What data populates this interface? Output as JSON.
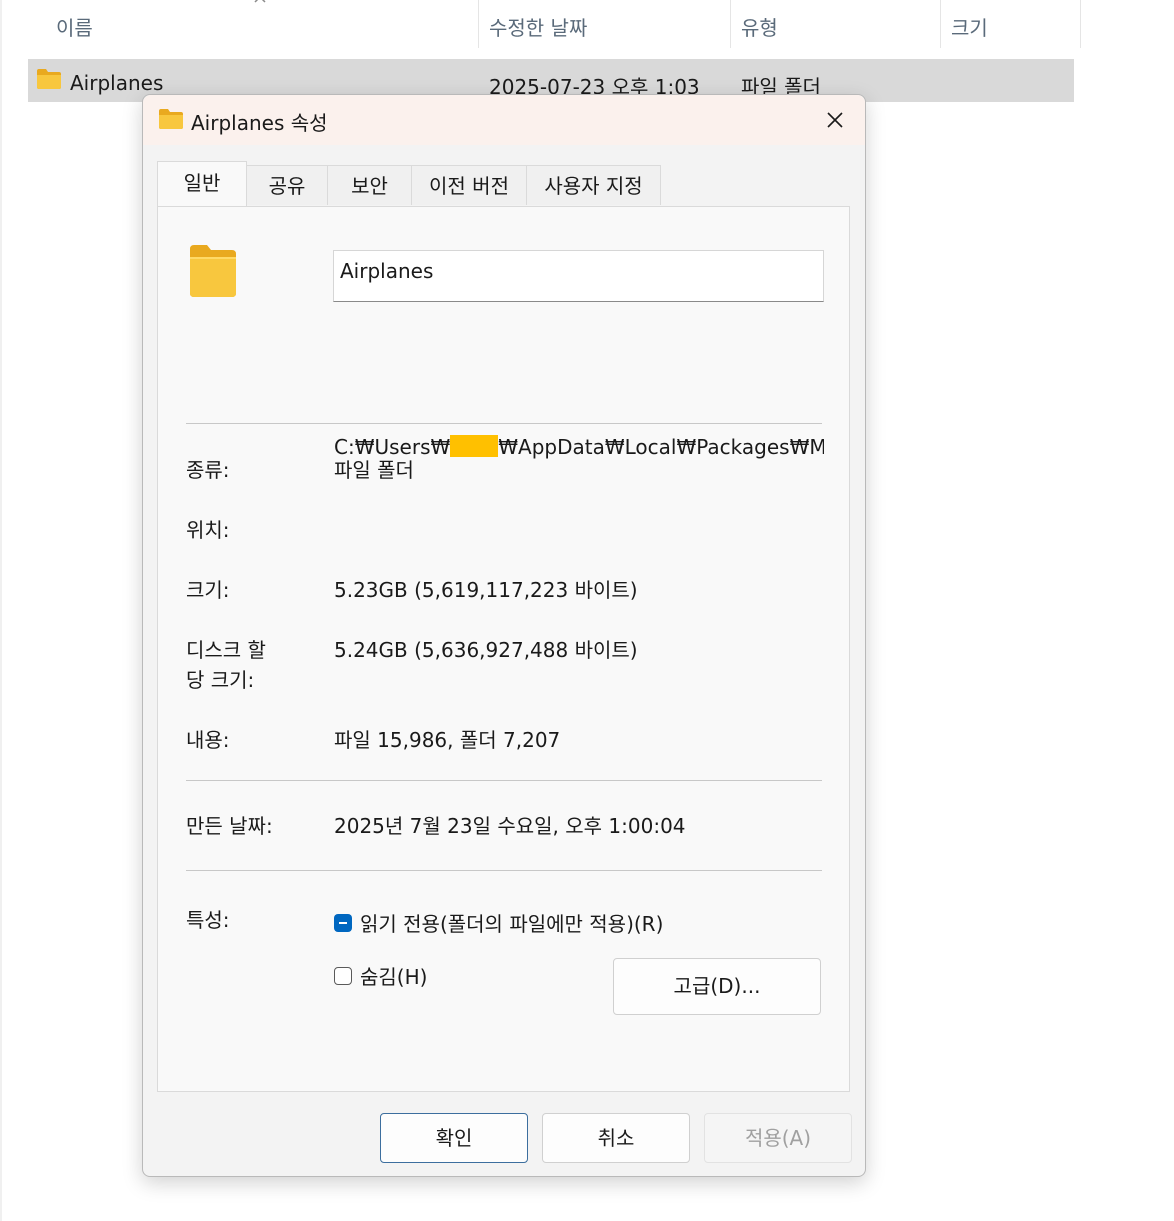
{
  "explorer": {
    "columns": [
      "이름",
      "수정한 날짜",
      "유형",
      "크기"
    ],
    "row": {
      "name": "Airplanes",
      "modified": "2025-07-23 오후 1:03",
      "type": "파일 폴더",
      "size": ""
    }
  },
  "dialog": {
    "title": "Airplanes 속성",
    "tabs": [
      "일반",
      "공유",
      "보안",
      "이전 버전",
      "사용자 지정"
    ],
    "name_value": "Airplanes",
    "props": {
      "type_label": "종류:",
      "type_value": "파일 폴더",
      "location_label": "위치:",
      "location_prefix": "C:₩Users₩",
      "location_suffix": "₩AppData₩Local₩Packages₩Micros",
      "size_label": "크기:",
      "size_value": "5.23GB (5,619,117,223 바이트)",
      "disk_label_1": "디스크 할",
      "disk_label_2": "당 크기:",
      "disk_value": "5.24GB (5,636,927,488 바이트)",
      "contains_label": "내용:",
      "contains_value": "파일 15,986, 폴더 7,207",
      "created_label": "만든 날짜:",
      "created_value": "2025년 7월 23일 수요일, 오후 1:00:04",
      "attributes_label": "특성:"
    },
    "readonly_label": "읽기 전용(폴더의 파일에만 적용)(R)",
    "hidden_label": "숨김(H)",
    "advanced_label": "고급(D)...",
    "ok_label": "확인",
    "cancel_label": "취소",
    "apply_label": "적용(A)"
  },
  "colors": {
    "folder": "#f8c73e",
    "redaction": "#ffc000",
    "checkbox_accent": "#0067c0"
  }
}
